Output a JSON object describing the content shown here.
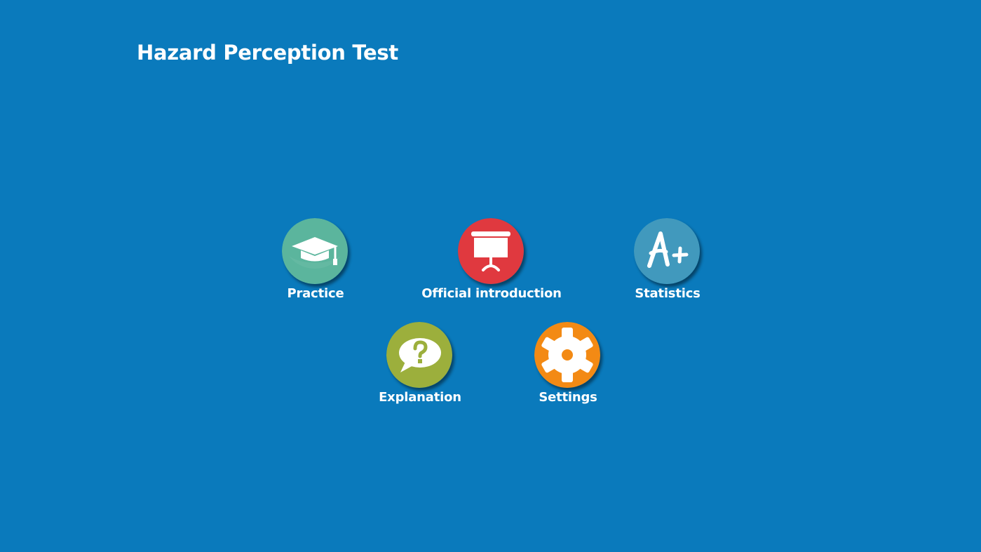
{
  "app": {
    "title": "Hazard Perception Test",
    "background_color": "#0a7abc"
  },
  "menu": {
    "practice": {
      "label": "Practice",
      "icon": "graduation-cap-icon",
      "color": "#5bb59d"
    },
    "official": {
      "label": "Official introduction",
      "icon": "presentation-board-icon",
      "color": "#e0393f"
    },
    "statistics": {
      "label": "Statistics",
      "icon": "grade-a-plus-icon",
      "color": "#4199bd"
    },
    "explanation": {
      "label": "Explanation",
      "icon": "question-speech-bubble-icon",
      "color": "#9caf3c"
    },
    "settings": {
      "label": "Settings",
      "icon": "gear-icon",
      "color": "#f38a14"
    }
  }
}
